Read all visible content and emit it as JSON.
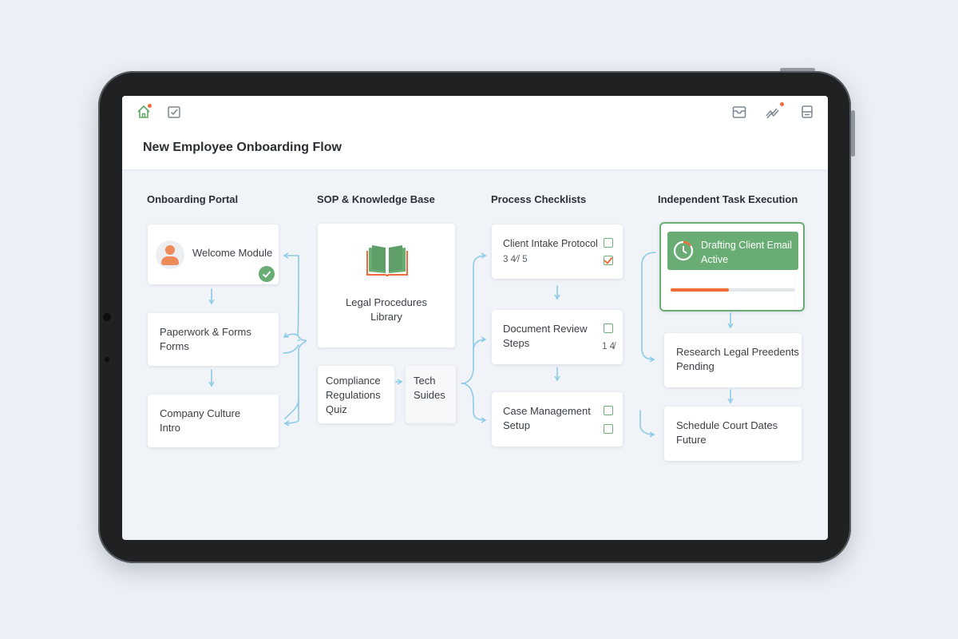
{
  "title": "New Employee Onboarding Flow",
  "topbar": {
    "left_icons": [
      "home-icon",
      "checkbox-icon"
    ],
    "right_icons": [
      "inbox-icon",
      "trend-icon",
      "server-icon"
    ]
  },
  "columns": {
    "portal": "Onboarding Portal",
    "sop": "SOP & Knowledge Base",
    "checklists": "Process Checklists",
    "execution": "Independent Task Execution"
  },
  "portal": {
    "welcome": "Welcome Module",
    "paperwork_line1": "Paperwork & Forms",
    "paperwork_line2": "Forms",
    "culture_line1": "Company Culture",
    "culture_line2": "Intro"
  },
  "sop": {
    "library_line1": "Legal Procedures",
    "library_line2": "Library",
    "compliance_line1": "Compliance",
    "compliance_line2": "Regulations",
    "compliance_line3": "Quiz",
    "tech_line1": "Tech",
    "tech_line2": "Suides"
  },
  "checklists": {
    "intake_title": "Client Intake Protocol",
    "intake_count": "3 4⁄/ 5",
    "review_line1": "Document Review",
    "review_line2": "Steps",
    "review_count": "1 4̸",
    "case_line1": "Case Management",
    "case_line2": "Setup"
  },
  "execution": {
    "active_line1": "Drafting Client Email",
    "active_line2": "Active",
    "active_progress": 0.47,
    "research_line1": "Research Legal Preedents",
    "research_line2": "Pending",
    "schedule_line1": "Schedule Court Dates",
    "schedule_line2": "Future"
  },
  "colors": {
    "accent_green": "#6aad74",
    "accent_orange": "#ef6c3a",
    "flow_blue": "#8ccbe6"
  }
}
